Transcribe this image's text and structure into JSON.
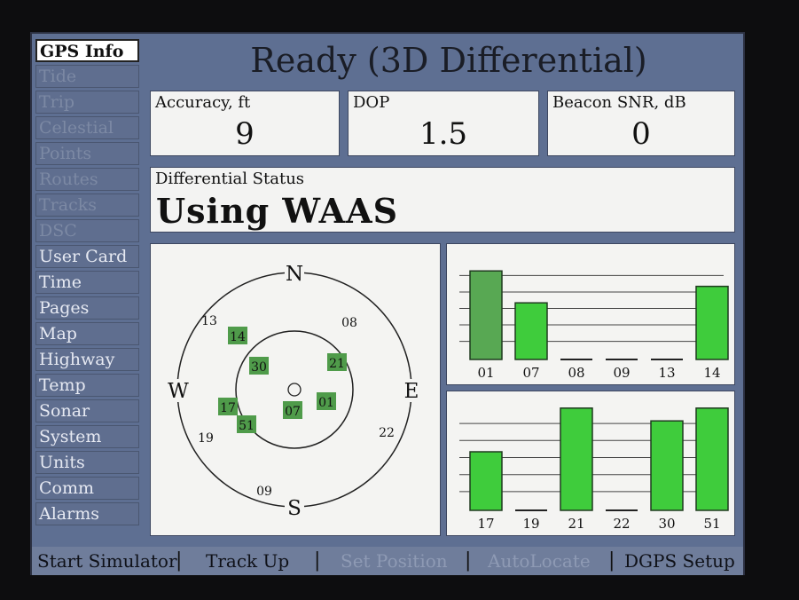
{
  "title": "Ready (3D Differential)",
  "tabs": [
    {
      "label": "GPS Info",
      "state": "selected"
    },
    {
      "label": "Tide",
      "state": "dim"
    },
    {
      "label": "Trip",
      "state": "dim"
    },
    {
      "label": "Celestial",
      "state": "dim"
    },
    {
      "label": "Points",
      "state": "dim"
    },
    {
      "label": "Routes",
      "state": "dim"
    },
    {
      "label": "Tracks",
      "state": "dim"
    },
    {
      "label": "DSC",
      "state": "dim"
    },
    {
      "label": "User Card",
      "state": "normal"
    },
    {
      "label": "Time",
      "state": "normal"
    },
    {
      "label": "Pages",
      "state": "normal"
    },
    {
      "label": "Map",
      "state": "normal"
    },
    {
      "label": "Highway",
      "state": "normal"
    },
    {
      "label": "Temp",
      "state": "normal"
    },
    {
      "label": "Sonar",
      "state": "normal"
    },
    {
      "label": "System",
      "state": "normal"
    },
    {
      "label": "Units",
      "state": "normal"
    },
    {
      "label": "Comm",
      "state": "normal"
    },
    {
      "label": "Alarms",
      "state": "normal"
    }
  ],
  "accuracy": {
    "label": "Accuracy, ft",
    "value": "9"
  },
  "dop": {
    "label": "DOP",
    "value": "1.5"
  },
  "beacon": {
    "label": "Beacon SNR, dB",
    "value": "0"
  },
  "differential": {
    "label": "Differential Status",
    "value": "Using WAAS"
  },
  "sky": {
    "compass": {
      "n": "N",
      "s": "S",
      "e": "E",
      "w": "W"
    },
    "satellites": [
      {
        "id": "13",
        "locked": false
      },
      {
        "id": "14",
        "locked": true
      },
      {
        "id": "08",
        "locked": false
      },
      {
        "id": "30",
        "locked": true
      },
      {
        "id": "21",
        "locked": true
      },
      {
        "id": "17",
        "locked": true
      },
      {
        "id": "07",
        "locked": true
      },
      {
        "id": "01",
        "locked": true
      },
      {
        "id": "51",
        "locked": true
      },
      {
        "id": "19",
        "locked": false
      },
      {
        "id": "22",
        "locked": false
      },
      {
        "id": "09",
        "locked": false
      }
    ]
  },
  "signal_top": [
    {
      "sat": "01",
      "level": 0.86,
      "state": "locked"
    },
    {
      "sat": "07",
      "level": 0.55,
      "state": "active"
    },
    {
      "sat": "08",
      "level": 0,
      "state": "none"
    },
    {
      "sat": "09",
      "level": 0,
      "state": "none"
    },
    {
      "sat": "13",
      "level": 0,
      "state": "none"
    },
    {
      "sat": "14",
      "level": 0.71,
      "state": "active"
    }
  ],
  "signal_bottom": [
    {
      "sat": "17",
      "level": 0.55,
      "state": "active"
    },
    {
      "sat": "19",
      "level": 0,
      "state": "none"
    },
    {
      "sat": "21",
      "level": 0.96,
      "state": "active"
    },
    {
      "sat": "22",
      "level": 0,
      "state": "none"
    },
    {
      "sat": "30",
      "level": 0.84,
      "state": "active"
    },
    {
      "sat": "51",
      "level": 0.96,
      "state": "active"
    }
  ],
  "softkeys": [
    {
      "label": "Start Simulator",
      "state": "normal"
    },
    {
      "label": "Track Up",
      "state": "normal"
    },
    {
      "label": "Set Position",
      "state": "dim"
    },
    {
      "label": "AutoLocate",
      "state": "dim"
    },
    {
      "label": "DGPS Setup",
      "state": "normal"
    }
  ],
  "colors": {
    "bar_active": "#3fcc3c",
    "bar_locked": "#58a853",
    "sat_locked": "#4f9b4a"
  }
}
